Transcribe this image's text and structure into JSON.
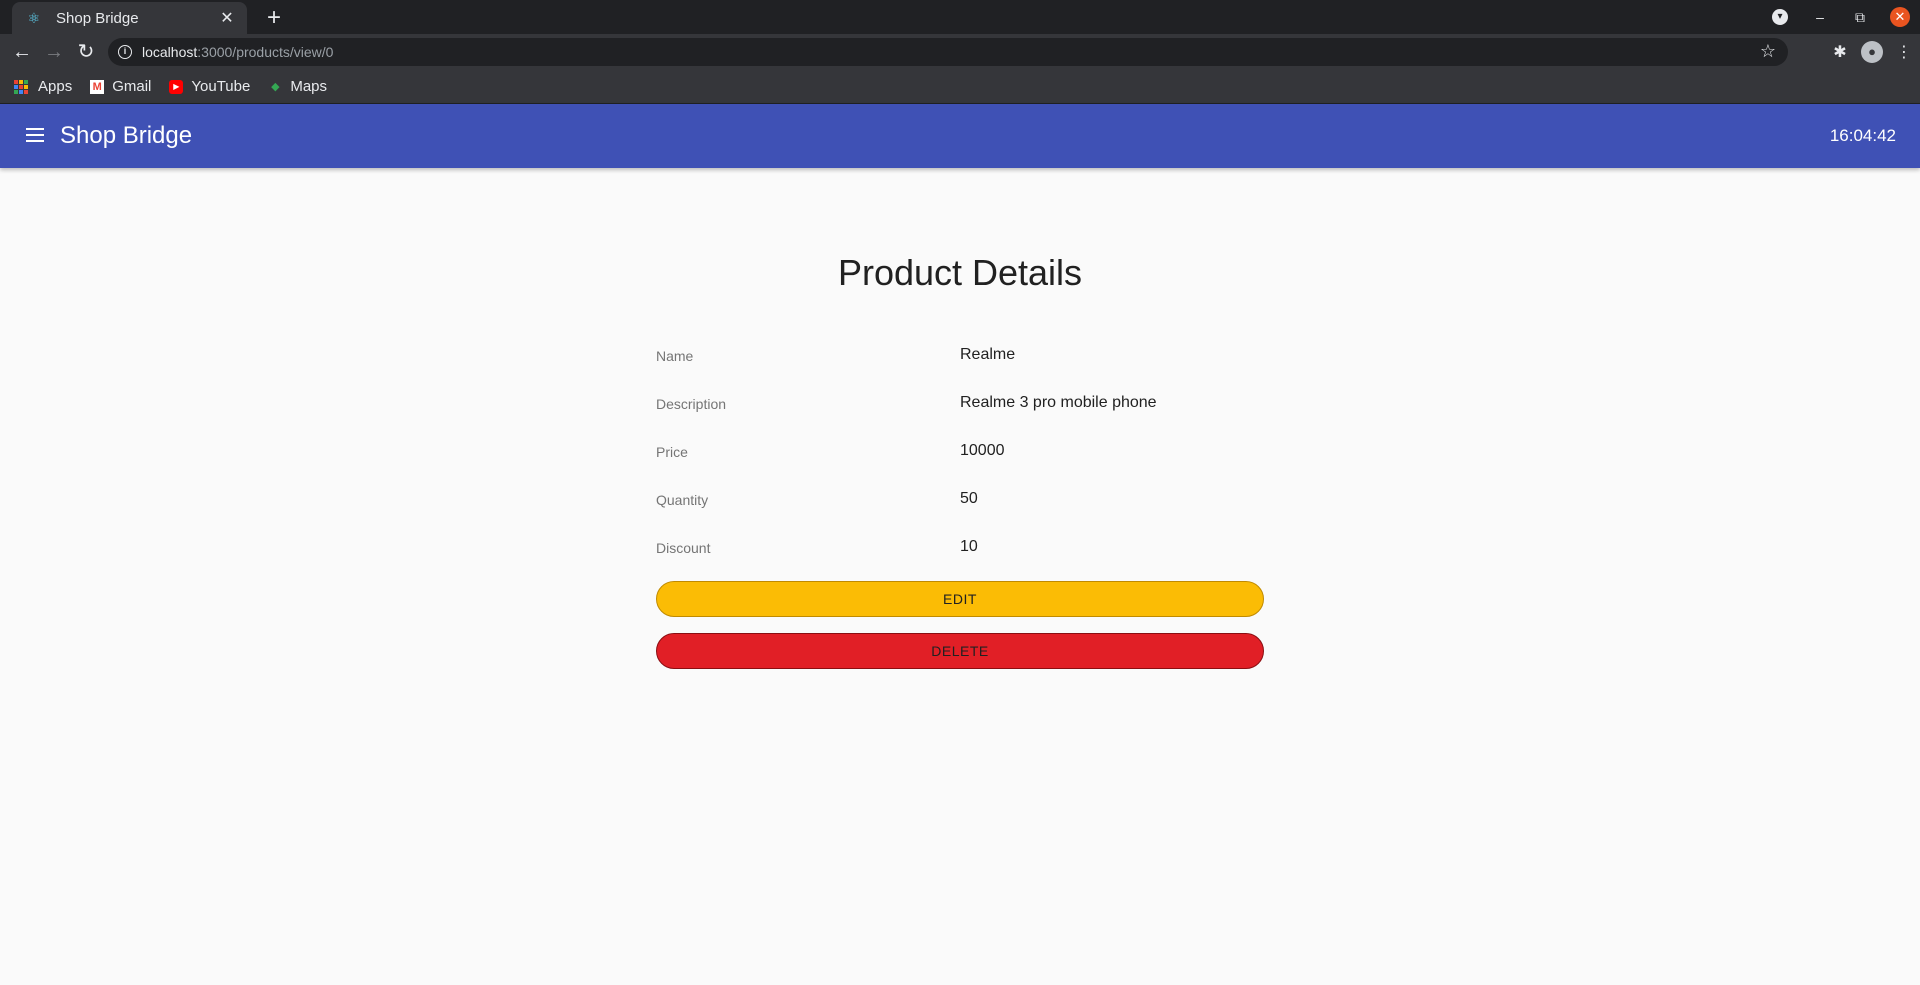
{
  "browser": {
    "tab_title": "Shop Bridge",
    "url_host": "localhost",
    "url_path": ":3000/products/view/0",
    "bookmarks": [
      {
        "label": "Apps",
        "icon": "apps-grid-icon"
      },
      {
        "label": "Gmail",
        "icon": "gmail-icon"
      },
      {
        "label": "YouTube",
        "icon": "youtube-icon"
      },
      {
        "label": "Maps",
        "icon": "maps-icon"
      }
    ]
  },
  "app": {
    "title": "Shop Bridge",
    "clock": "16:04:42",
    "accent_color": "#3f51b5"
  },
  "product": {
    "heading": "Product Details",
    "fields": [
      {
        "label": "Name",
        "value": "Realme"
      },
      {
        "label": "Description",
        "value": "Realme 3 pro mobile phone"
      },
      {
        "label": "Price",
        "value": "10000"
      },
      {
        "label": "Quantity",
        "value": "50"
      },
      {
        "label": "Discount",
        "value": "10"
      }
    ],
    "edit_label": "EDIT",
    "delete_label": "DELETE",
    "edit_color": "#fbbc05",
    "delete_color": "#e11f26"
  }
}
